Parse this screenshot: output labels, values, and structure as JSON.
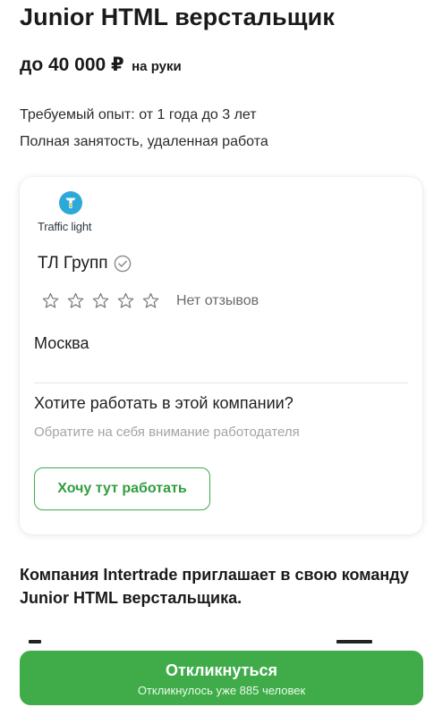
{
  "vacancy": {
    "title": "Junior HTML верстальщик",
    "salary_amount": "до 40 000 ₽",
    "salary_note": "на руки",
    "experience": "Требуемый опыт: от 1 года до 3 лет",
    "employment": "Полная занятость, удаленная работа"
  },
  "company": {
    "logo_text": "Traffic light",
    "logo_color": "#2ca9d8",
    "name": "ТЛ Групп",
    "verified_icon": "check-circle-icon",
    "rating_stars": 0,
    "rating_max": 5,
    "reviews_text": "Нет отзывов",
    "city": "Москва",
    "want_title": "Хотите работать в этой компании?",
    "want_subtitle": "Обратите на себя внимание работодателя",
    "want_button": "Хочу тут работать"
  },
  "description": {
    "intro": "Компания Intertrade приглашает в свою команду Junior HTML верстальщика."
  },
  "respond": {
    "label": "Откликнуться",
    "sublabel": "Откликнулось уже 885 человек"
  },
  "colors": {
    "accent_green": "#3fac49",
    "outline_green": "#3fa94d",
    "muted_text": "#a4a4a4"
  }
}
